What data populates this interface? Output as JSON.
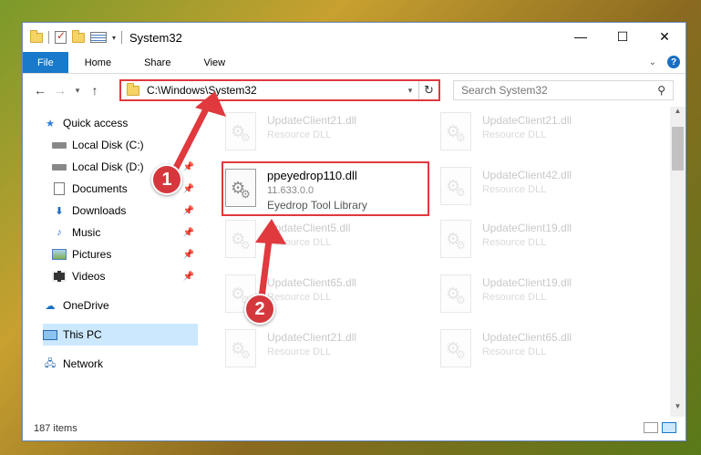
{
  "window": {
    "title": "System32",
    "controls": {
      "minimize": "—",
      "maximize": "☐",
      "close": "✕"
    }
  },
  "ribbon": {
    "tabs": [
      "File",
      "Home",
      "Share",
      "View"
    ],
    "help": "?"
  },
  "address": {
    "path": "C:\\Windows\\System32",
    "search_placeholder": "Search System32"
  },
  "nav_pane": {
    "quick_access": "Quick access",
    "items": [
      {
        "label": "Local Disk (C:)",
        "icon": "disk-icon",
        "pinned": false
      },
      {
        "label": "Local Disk (D:)",
        "icon": "disk-icon",
        "pinned": true
      },
      {
        "label": "Documents",
        "icon": "documents-icon",
        "pinned": true
      },
      {
        "label": "Downloads",
        "icon": "downloads-icon",
        "pinned": true
      },
      {
        "label": "Music",
        "icon": "music-icon",
        "pinned": true
      },
      {
        "label": "Pictures",
        "icon": "pictures-icon",
        "pinned": true
      },
      {
        "label": "Videos",
        "icon": "videos-icon",
        "pinned": true
      }
    ],
    "onedrive": "OneDrive",
    "this_pc": "This PC",
    "network": "Network"
  },
  "files": [
    {
      "name": "UpdateClient21.dll",
      "type": "Resource DLL"
    },
    {
      "name": "UpdateClient21.dll",
      "type": "Resource DLL"
    },
    {
      "name": "UpdateClient42.dll",
      "type": "Resource DLL"
    },
    {
      "name": "UpdateClient5.dll",
      "type": "Resource DLL"
    },
    {
      "name": "UpdateClient19.dll",
      "type": "Resource DLL"
    },
    {
      "name": "UpdateClient65.dll",
      "type": "Resource DLL"
    },
    {
      "name": "UpdateClient19.dll",
      "type": "Resource DLL"
    },
    {
      "name": "UpdateClient21.dll",
      "type": "Resource DLL"
    },
    {
      "name": "UpdateClient65.dll",
      "type": "Resource DLL"
    }
  ],
  "focused_file": {
    "name": "ppeyedrop110.dll",
    "version": "11.633.0.0",
    "description": "Eyedrop Tool Library"
  },
  "status": {
    "item_count": "187 items"
  },
  "annotations": {
    "step1": "1",
    "step2": "2",
    "highlight_color": "#e0393e"
  }
}
